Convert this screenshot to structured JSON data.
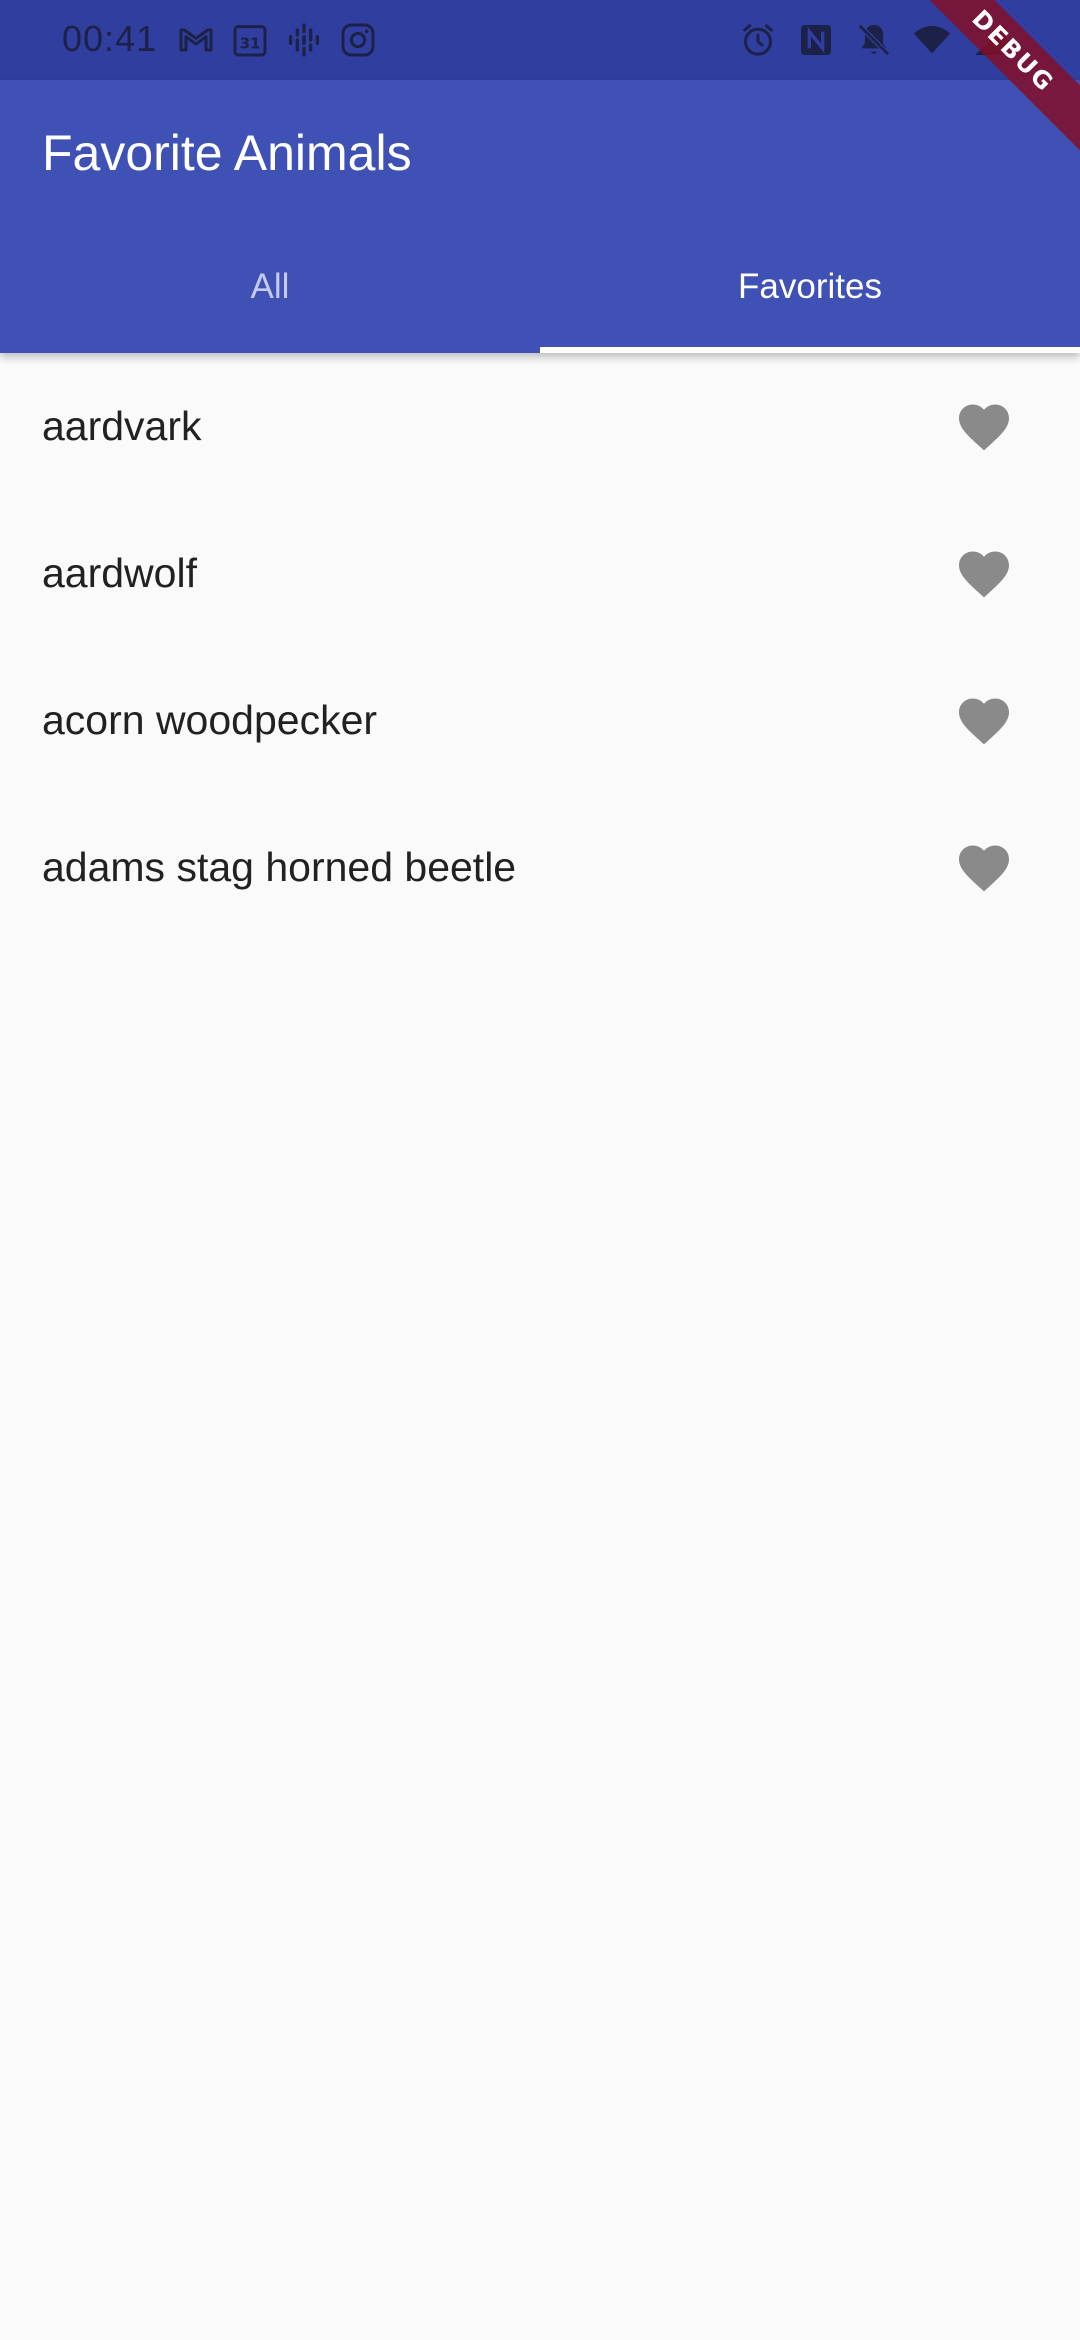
{
  "status_bar": {
    "time": "00:41",
    "left_icons": [
      "gmail-icon",
      "calendar-icon",
      "podcasts-icon",
      "instagram-icon"
    ],
    "calendar_day": "31",
    "right_icons": [
      "alarm-icon",
      "nfc-icon",
      "mute-icon",
      "wifi-icon",
      "signal-icon"
    ]
  },
  "app_bar": {
    "title": "Favorite Animals",
    "color": "#3f51b5"
  },
  "tabs": [
    {
      "label": "All",
      "selected": false
    },
    {
      "label": "Favorites",
      "selected": true
    }
  ],
  "favorites": [
    {
      "name": "aardvark",
      "icon": "heart-icon"
    },
    {
      "name": "aardwolf",
      "icon": "heart-icon"
    },
    {
      "name": "acorn woodpecker",
      "icon": "heart-icon"
    },
    {
      "name": "adams stag horned beetle",
      "icon": "heart-icon"
    }
  ],
  "debug_banner": "DEBUG",
  "colors": {
    "status_bar": "#303f9f",
    "app_bar": "#3f51b5",
    "heart": "#8a8a8a",
    "background": "#fafafa"
  }
}
